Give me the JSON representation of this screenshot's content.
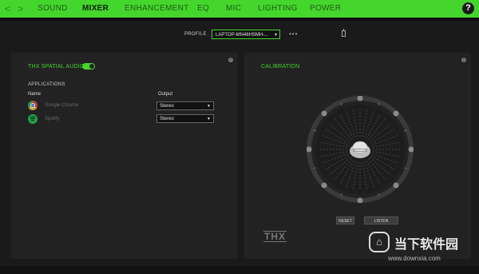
{
  "nav": {
    "tabs": [
      {
        "label": "SOUND",
        "active": false
      },
      {
        "label": "MIXER",
        "active": true
      },
      {
        "label": "ENHANCEMENT",
        "active": false
      },
      {
        "label": "EQ",
        "active": false
      },
      {
        "label": "MIC",
        "active": false
      },
      {
        "label": "LIGHTING",
        "active": false
      },
      {
        "label": "POWER",
        "active": false
      }
    ],
    "help_label": "?",
    "back_glyph": "<",
    "forward_glyph": ">"
  },
  "profile": {
    "label": "PROFILE",
    "value": "LAPTOP-MN48HSMH-...",
    "more_label": "•••"
  },
  "mixer": {
    "title": "THX SPATIAL AUDIO",
    "toggle_on": true,
    "section_label": "APPLICATIONS",
    "col_name": "Name",
    "col_output": "Output",
    "apps": [
      {
        "name": "Google Chrome",
        "output": "Stereo",
        "icon": "chrome-icon"
      },
      {
        "name": "Spotify",
        "output": "Stereo",
        "icon": "spotify-icon"
      }
    ]
  },
  "calibration": {
    "title": "CALIBRATION",
    "reset_label": "RESET",
    "listen_label": "LISTEN",
    "logo_text": "THX"
  },
  "watermark": {
    "text": "当下软件园",
    "url": "www.downxia.com"
  },
  "colors": {
    "accent": "#44d62c",
    "panel": "#222222",
    "background": "#1a1a1a"
  }
}
